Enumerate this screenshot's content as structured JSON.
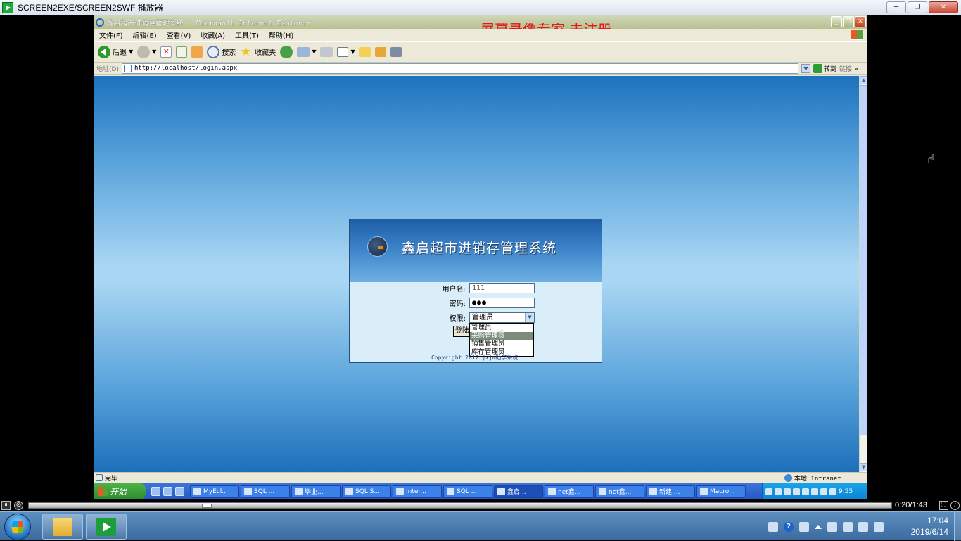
{
  "player": {
    "title": "SCREEN2EXE/SCREEN2SWF 播放器",
    "time": "0:20/1:43",
    "progress": 0.203,
    "controls": {
      "pause": "⏸",
      "stop": "⊘",
      "fit": "⛶",
      "info": "i"
    }
  },
  "ie": {
    "title": "鑫启超市进销存管理系统 - Microsoft Internet Explorer",
    "watermark": "屏幕录像专家  未注册",
    "menu": [
      "文件(F)",
      "编辑(E)",
      "查看(V)",
      "收藏(A)",
      "工具(T)",
      "帮助(H)"
    ],
    "toolbar": {
      "back": "后退",
      "search": "搜索",
      "favorites": "收藏夹"
    },
    "address": {
      "label": "地址(D)",
      "url": "http://localhost/login.aspx",
      "go": "转到",
      "links": "链接"
    },
    "status": {
      "text": "完毕",
      "zone": "本地 Intranet"
    }
  },
  "login": {
    "system_title": "鑫启超市进销存管理系统",
    "username_label": "用户名:",
    "username_value": "111",
    "password_label": "密码:",
    "password_value": "●●●",
    "role_label": "权限:",
    "role_selected": "管理员",
    "role_options": [
      "管理员",
      "采购管理员",
      "销售管理员",
      "库存管理员"
    ],
    "highlighted_option": "采购管理员",
    "login_button": "登陆",
    "copyright": "Copyright 2012 jxjm助学系统"
  },
  "xp_taskbar": {
    "start": "开始",
    "tasks": [
      {
        "label": "MyEcl...",
        "active": false
      },
      {
        "label": "SQL ...",
        "active": false
      },
      {
        "label": "毕业...",
        "active": false
      },
      {
        "label": "SQL S...",
        "active": false
      },
      {
        "label": "Inter...",
        "active": false
      },
      {
        "label": "SQL ...",
        "active": false
      },
      {
        "label": "鑫启...",
        "active": true
      },
      {
        "label": "net鑫...",
        "active": false
      },
      {
        "label": "net鑫...",
        "active": false
      },
      {
        "label": "新建 ...",
        "active": false
      },
      {
        "label": "Macro...",
        "active": false
      }
    ],
    "clock": "9:55"
  },
  "win7_taskbar": {
    "time": "17:04",
    "date": "2019/6/14"
  }
}
